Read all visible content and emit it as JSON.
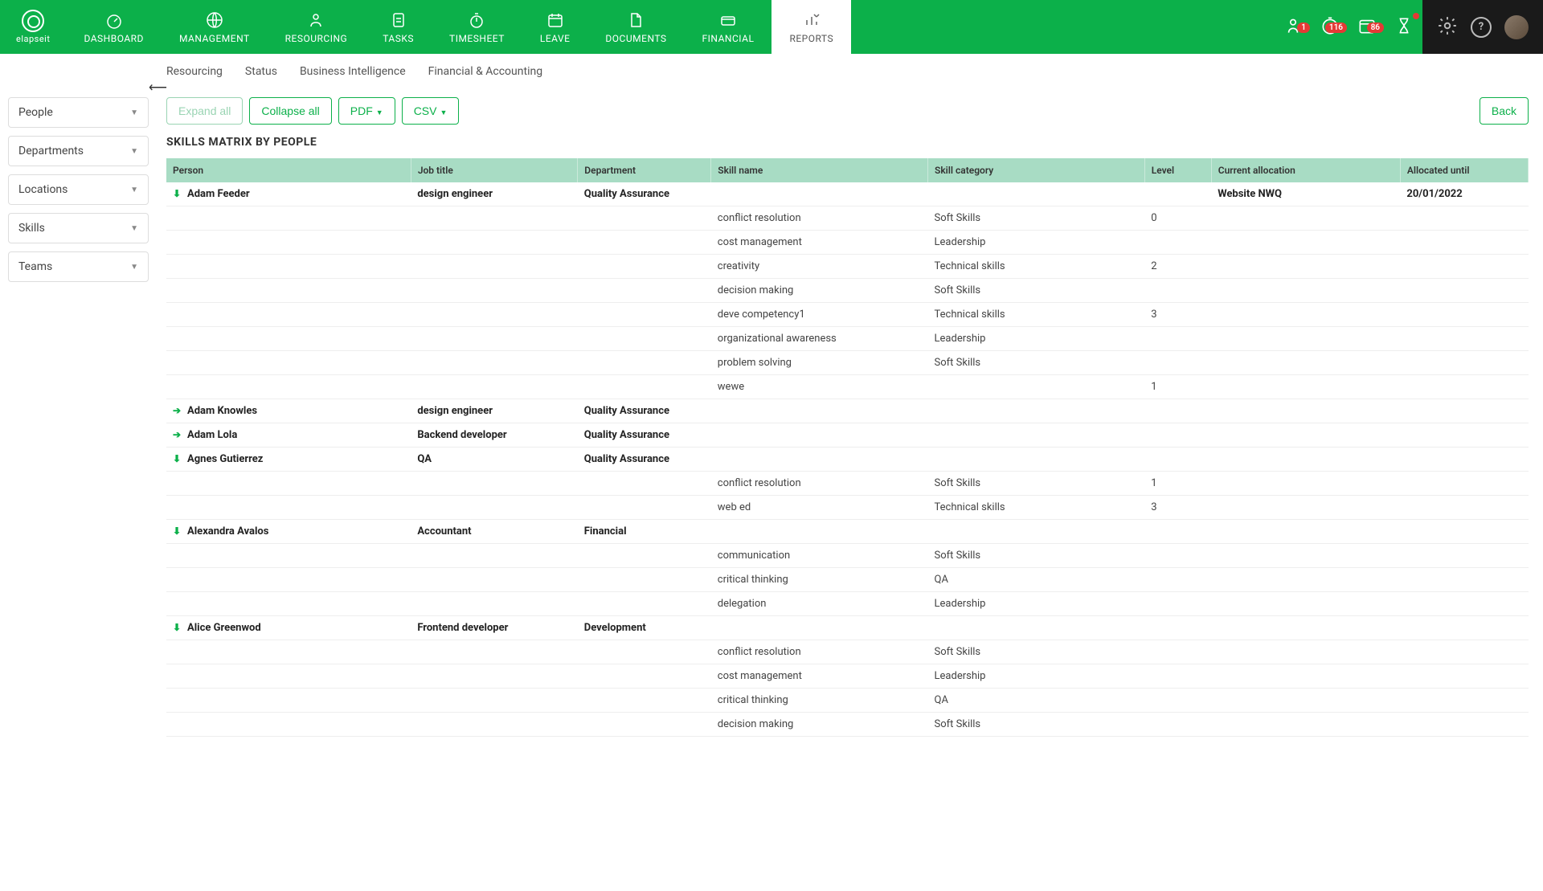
{
  "brand": "elapseit",
  "nav": [
    {
      "label": "DASHBOARD"
    },
    {
      "label": "MANAGEMENT"
    },
    {
      "label": "RESOURCING"
    },
    {
      "label": "TASKS"
    },
    {
      "label": "TIMESHEET"
    },
    {
      "label": "LEAVE"
    },
    {
      "label": "DOCUMENTS"
    },
    {
      "label": "FINANCIAL"
    },
    {
      "label": "REPORTS"
    }
  ],
  "badges": {
    "bell": "1",
    "clock": "116",
    "calendar": "86"
  },
  "subtabs": [
    "Resourcing",
    "Status",
    "Business Intelligence",
    "Financial & Accounting"
  ],
  "filters": [
    "People",
    "Departments",
    "Locations",
    "Skills",
    "Teams"
  ],
  "toolbar": {
    "expand": "Expand all",
    "collapse": "Collapse all",
    "pdf": "PDF",
    "csv": "CSV",
    "back": "Back"
  },
  "title": "SKILLS MATRIX BY PEOPLE",
  "columns": [
    "Person",
    "Job title",
    "Department",
    "Skill name",
    "Skill category",
    "Level",
    "Current allocation",
    "Allocated until"
  ],
  "rows": [
    {
      "type": "person",
      "expanded": true,
      "person": "Adam Feeder",
      "job": "design engineer",
      "dept": "Quality Assurance",
      "alloc": "Website NWQ",
      "until": "20/01/2022"
    },
    {
      "type": "skill",
      "skill": "conflict resolution",
      "cat": "Soft Skills",
      "level": "0"
    },
    {
      "type": "skill",
      "skill": "cost management",
      "cat": "Leadership",
      "level": ""
    },
    {
      "type": "skill",
      "skill": "creativity",
      "cat": "Technical skills",
      "level": "2"
    },
    {
      "type": "skill",
      "skill": "decision making",
      "cat": "Soft Skills",
      "level": ""
    },
    {
      "type": "skill",
      "skill": "deve competency1",
      "cat": "Technical skills",
      "level": "3"
    },
    {
      "type": "skill",
      "skill": "organizational awareness",
      "cat": "Leadership",
      "level": ""
    },
    {
      "type": "skill",
      "skill": "problem solving",
      "cat": "Soft Skills",
      "level": ""
    },
    {
      "type": "skill",
      "skill": "wewe",
      "cat": "",
      "level": "1"
    },
    {
      "type": "person",
      "expanded": false,
      "person": "Adam Knowles",
      "job": "design engineer",
      "dept": "Quality Assurance"
    },
    {
      "type": "person",
      "expanded": false,
      "person": "Adam Lola",
      "job": "Backend developer",
      "dept": "Quality Assurance"
    },
    {
      "type": "person",
      "expanded": true,
      "person": "Agnes Gutierrez",
      "job": "QA",
      "dept": "Quality Assurance"
    },
    {
      "type": "skill",
      "skill": "conflict resolution",
      "cat": "Soft Skills",
      "level": "1"
    },
    {
      "type": "skill",
      "skill": "web ed",
      "cat": "Technical skills",
      "level": "3"
    },
    {
      "type": "person",
      "expanded": true,
      "person": "Alexandra Avalos",
      "job": "Accountant",
      "dept": "Financial"
    },
    {
      "type": "skill",
      "skill": "communication",
      "cat": "Soft Skills",
      "level": ""
    },
    {
      "type": "skill",
      "skill": "critical thinking",
      "cat": "QA",
      "level": ""
    },
    {
      "type": "skill",
      "skill": "delegation",
      "cat": "Leadership",
      "level": ""
    },
    {
      "type": "person",
      "expanded": true,
      "person": "Alice Greenwod",
      "job": "Frontend developer",
      "dept": "Development"
    },
    {
      "type": "skill",
      "skill": "conflict resolution",
      "cat": "Soft Skills",
      "level": ""
    },
    {
      "type": "skill",
      "skill": "cost management",
      "cat": "Leadership",
      "level": ""
    },
    {
      "type": "skill",
      "skill": "critical thinking",
      "cat": "QA",
      "level": ""
    },
    {
      "type": "skill",
      "skill": "decision making",
      "cat": "Soft Skills",
      "level": ""
    }
  ]
}
